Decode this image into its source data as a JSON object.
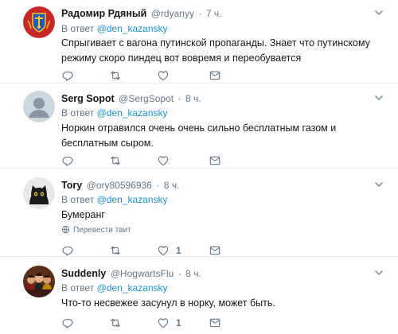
{
  "tweets": [
    {
      "name": "Радомир Рдяный",
      "handle": "@rdyanyy",
      "separator": "·",
      "time": "7 ч.",
      "reply_prefix": "В ответ",
      "reply_to": "@den_kazansky",
      "text": "Спрыгивает с вагона путинской пропаганды. Знает что путинскому режиму скоро пиндец вот вовремя и переобувается",
      "like_count": "",
      "avatar": "coat-of-arms"
    },
    {
      "name": "Serg Sopot",
      "handle": "@SergSopot",
      "separator": "·",
      "time": "8 ч.",
      "reply_prefix": "В ответ",
      "reply_to": "@den_kazansky",
      "text": "Норкин отравился очень очень сильно бесплатным газом и бесплатным сыром.",
      "like_count": "",
      "avatar": "default-egg"
    },
    {
      "name": "Tory",
      "handle": "@ory80596936",
      "separator": "·",
      "time": "8 ч.",
      "reply_prefix": "В ответ",
      "reply_to": "@den_kazansky",
      "text": "Бумеранг",
      "translate_label": "Перевести твит",
      "like_count": "1",
      "avatar": "black-cat"
    },
    {
      "name": "Suddenly",
      "handle": "@HogwartsFlu",
      "separator": "·",
      "time": "8 ч.",
      "reply_prefix": "В ответ",
      "reply_to": "@den_kazansky",
      "text": "Что-то несвежее засунул в норку, может быть.",
      "like_count": "1",
      "avatar": "group-photo"
    }
  ],
  "colors": {
    "link": "#1b95e0",
    "secondary": "#657786",
    "text": "#14171a",
    "divider": "#e6ecf0"
  }
}
